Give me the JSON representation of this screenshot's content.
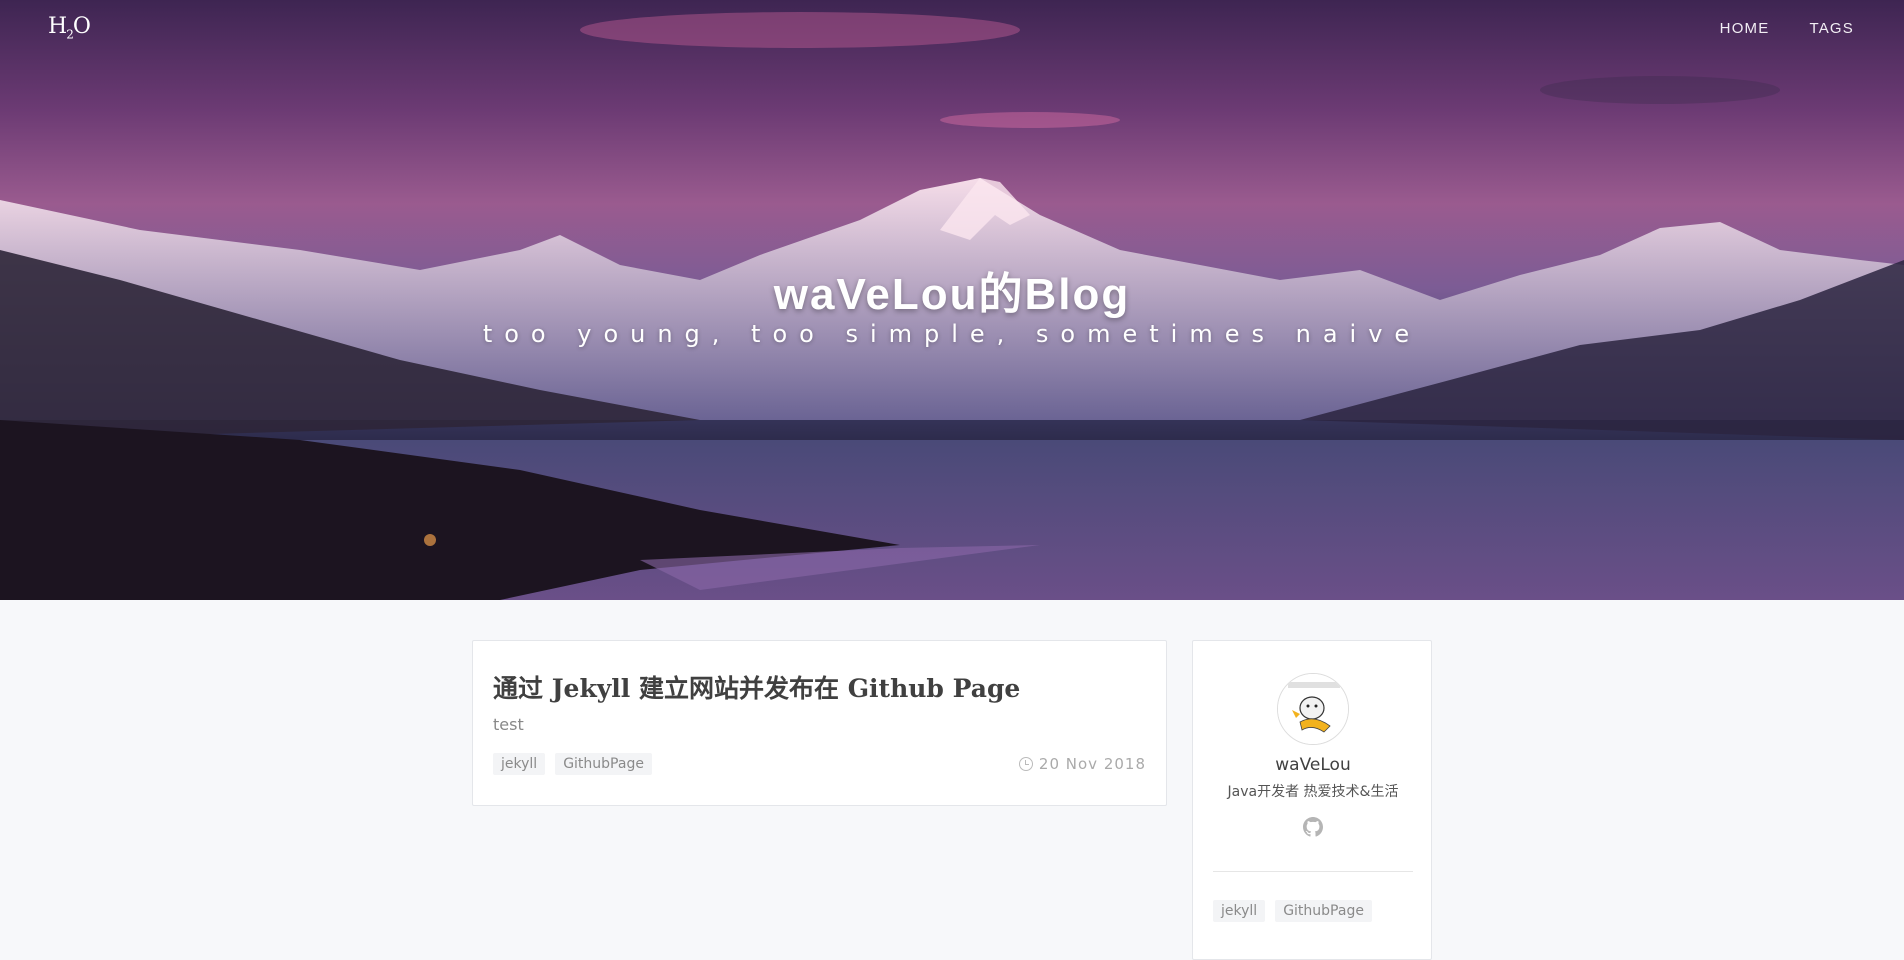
{
  "nav": {
    "logo": {
      "main": "H",
      "sub": "2",
      "tail": "O"
    },
    "links": [
      {
        "label": "HOME"
      },
      {
        "label": "TAGS"
      }
    ]
  },
  "hero": {
    "title": "waVeLou的Blog",
    "subtitle": "too young, too simple, sometimes naive"
  },
  "posts": [
    {
      "title": "通过 Jekyll 建立网站并发布在 Github Page",
      "excerpt": "test",
      "tags": [
        "jekyll",
        "GithubPage"
      ],
      "date": "20 Nov 2018"
    }
  ],
  "sidebar": {
    "author_name": "waVeLou",
    "author_bio": "Java开发者 热爱技术&生活",
    "social_icon": "github-icon",
    "tags": [
      "jekyll",
      "GithubPage"
    ]
  }
}
